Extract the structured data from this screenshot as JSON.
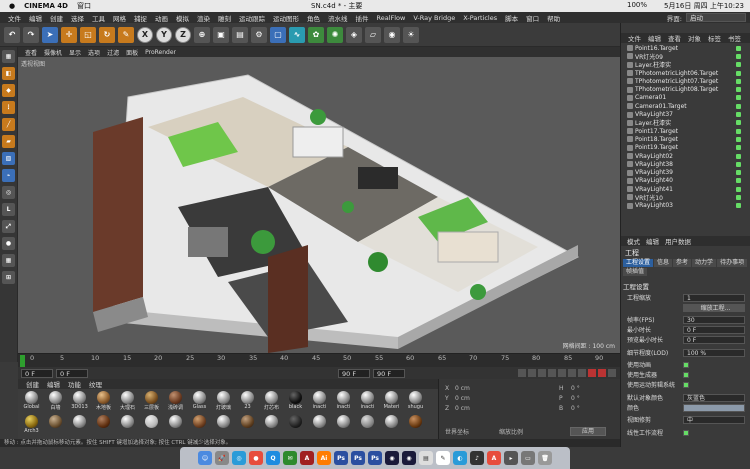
{
  "mac_menubar": {
    "app": "CINEMA 4D",
    "menu": "窗口",
    "status_right": [
      "100%",
      "5月16日 周四 上午10:23"
    ]
  },
  "window_title": "SN.c4d * - 主要",
  "app_menu": {
    "items": [
      "文件",
      "编辑",
      "创建",
      "选择",
      "工具",
      "网格",
      "捕捉",
      "动画",
      "模拟",
      "渲染",
      "雕刻",
      "运动跟踪",
      "运动图形",
      "角色",
      "流水线",
      "插件",
      "RealFlow",
      "V-Ray Bridge",
      "X-Particles",
      "脚本",
      "窗口",
      "帮助"
    ],
    "layout_label": "界面:",
    "layout_value": "启动"
  },
  "toolbar": {
    "axis_buttons": [
      "X",
      "Y",
      "Z"
    ]
  },
  "viewport": {
    "menu": [
      "查看",
      "摄像机",
      "显示",
      "选项",
      "过滤",
      "面板",
      "ProRender"
    ],
    "label": "透视视图",
    "grid_text": "网格间距 : 100 cm"
  },
  "timeline": {
    "ticks": [
      "0",
      "5",
      "10",
      "15",
      "20",
      "25",
      "30",
      "35",
      "40",
      "45",
      "50",
      "55",
      "60",
      "65",
      "70",
      "75",
      "80",
      "85",
      "90"
    ],
    "frame_start": "0 F",
    "frame_min": "0 F",
    "frame_max": "90 F",
    "frame_end": "90 F"
  },
  "materials_menu": [
    "创建",
    "编辑",
    "功能",
    "纹理"
  ],
  "materials": [
    "Global",
    "白墙",
    "3D013",
    "木地板",
    "大理石",
    "三层板",
    "浅砖调",
    "Glass",
    "灯玻璃",
    "23",
    "灯芯布",
    "inacti",
    "black",
    "inacti",
    "inacti",
    "Materi",
    "shugu",
    "Arch3",
    "",
    "",
    "",
    "",
    "",
    "",
    "",
    "",
    "",
    "",
    "",
    "",
    "",
    "",
    "",
    "",
    ""
  ],
  "coords": {
    "pos_labels": [
      "X",
      "Y",
      "Z"
    ],
    "pos_values": [
      "0 cm",
      "0 cm",
      "0 cm"
    ],
    "rot_labels": [
      "H",
      "P",
      "B"
    ],
    "rot_values": [
      "0 °",
      "0 °",
      "0 °"
    ],
    "mode": "世界坐标",
    "scale_mode": "缩放比例",
    "apply": "应用"
  },
  "status_text": "移动 : 点击并拖动鼠标移动元素。按住 SHIFT 键增加选择对象; 按住 CTRL 键减少选择对象。",
  "objects": {
    "menu": [
      "文件",
      "编辑",
      "查看",
      "对象",
      "标签",
      "书签"
    ],
    "items": [
      "Point16.Target",
      "VR灯光09",
      "Layer.柱漆实",
      "TPhotometricLight06.Target",
      "TPhotometricLight07.Target",
      "TPhotometricLight08.Target",
      "Camera01",
      "Camera01.Target",
      "VRayLight37",
      "Layer.柱漆实",
      "Point17.Target",
      "Point18.Target",
      "Point19.Target",
      "VRayLight02",
      "VRayLight38",
      "VRayLight39",
      "VRayLight40",
      "VRayLight41",
      "VR灯光10",
      "VRayLight03"
    ]
  },
  "attributes": {
    "menu": [
      "模式",
      "编辑",
      "用户数据"
    ],
    "title": "工程",
    "tabs": [
      "工程设置",
      "信息",
      "参考",
      "动力学",
      "待办事项",
      "帧插值"
    ],
    "section": "工程设置",
    "rows": [
      {
        "label": "工程缩放",
        "value": "1"
      },
      {
        "label": "",
        "value": "缩放工程..."
      },
      {
        "label": "帧率(FPS)",
        "value": "30"
      },
      {
        "label": "最小时长",
        "value": "0 F"
      },
      {
        "label": "预览最小时长",
        "value": "0 F"
      },
      {
        "label": "细节程度(LOD)",
        "value": "100 %"
      },
      {
        "label": "使用动画",
        "value": ""
      },
      {
        "label": "使用生成器",
        "value": ""
      },
      {
        "label": "使用运动剪辑系统",
        "value": ""
      },
      {
        "label": "默认对象颜色",
        "value": "灰蓝色"
      },
      {
        "label": "颜色",
        "value": ""
      },
      {
        "label": "视图修剪",
        "value": "中"
      },
      {
        "label": "线性工作流程",
        "value": ""
      }
    ]
  },
  "colors": {
    "accent": "#2c5f9e",
    "timeline_start": "#2e9f2e"
  }
}
